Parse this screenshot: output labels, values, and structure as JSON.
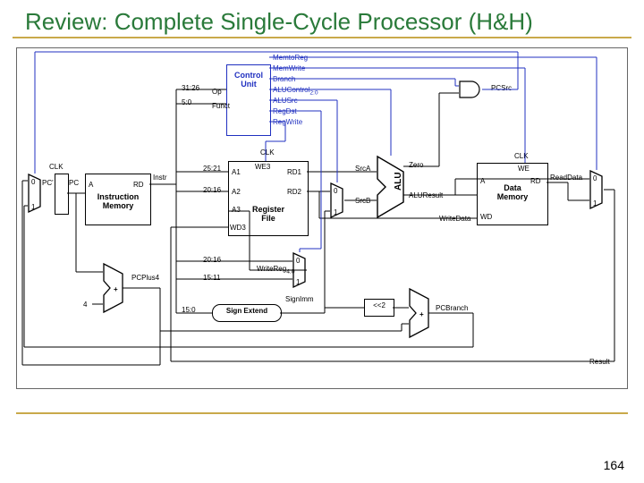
{
  "title": "Review: Complete Single-Cycle Processor (H&H)",
  "page_number": "164",
  "labels": {
    "control_unit": "Control\nUnit",
    "memtoreg": "MemtoReg",
    "memwrite": "MemWrite",
    "branch": "Branch",
    "alucontrol": "ALUControl",
    "alucontrol_sub": "2:0",
    "alusrc": "ALUSrc",
    "regdst": "RegDst",
    "regwrite": "RegWrite",
    "op": "Op",
    "funct": "Funct",
    "bits_3126": "31:26",
    "bits_50": "5:0",
    "clk": "CLK",
    "pc_prime": "PC'",
    "pc": "PC",
    "instr_mem": "Instruction\nMemory",
    "a": "A",
    "rd": "RD",
    "instr": "Instr",
    "reg_file": "Register\nFile",
    "a1": "A1",
    "a2": "A2",
    "a3": "A3",
    "wd3": "WD3",
    "we3": "WE3",
    "rd1": "RD1",
    "rd2": "RD2",
    "bits_2521": "25:21",
    "bits_2016": "20:16",
    "bits_1511": "15:11",
    "bits_150": "15:0",
    "writereg": "WriteReg",
    "writereg_sub": "4:0",
    "sign_extend": "Sign Extend",
    "signimm": "SignImm",
    "mux01_0": "0",
    "mux01_1": "1",
    "srca": "SrcA",
    "srcb": "SrcB",
    "alu": "ALU",
    "zero": "Zero",
    "aluresult": "ALUResult",
    "data_mem": "Data\nMemory",
    "we": "WE",
    "writedata": "WriteData",
    "readdata": "ReadData",
    "shl2": "<<2",
    "plus": "+",
    "pcplus4": "PCPlus4",
    "four": "4",
    "pcbranch": "PCBranch",
    "pcsrc": "PCSrc",
    "result": "Result",
    "wd": "WD"
  }
}
